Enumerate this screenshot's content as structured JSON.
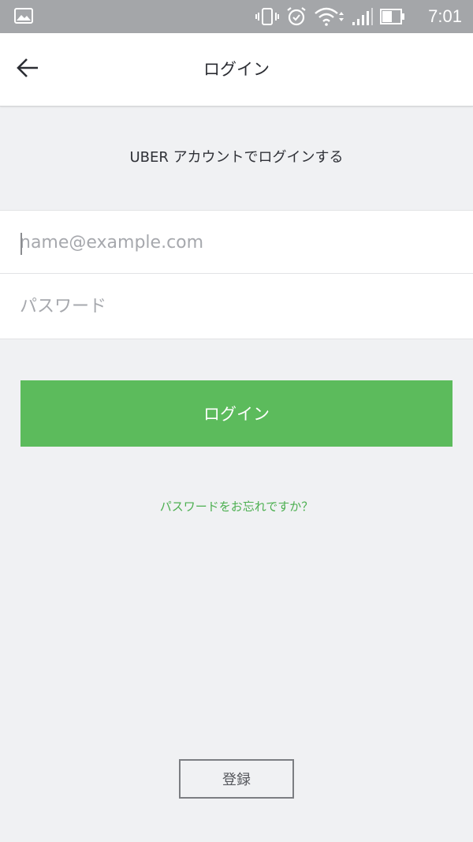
{
  "status_bar": {
    "time": "7:01",
    "icons": [
      "image-notification-icon",
      "vibrate-icon",
      "alarm-icon",
      "wifi-icon",
      "signal-icon",
      "battery-icon"
    ]
  },
  "header": {
    "title": "ログイン",
    "back_icon": "arrow-left-icon"
  },
  "main": {
    "subtitle": "UBER アカウントでログインする",
    "email_placeholder": "name@example.com",
    "password_placeholder": "パスワード",
    "login_label": "ログイン",
    "forgot_password": "パスワードをお忘れですか？",
    "register_label": "登録"
  },
  "colors": {
    "primary_green": "#5cbb5c",
    "link_green": "#4caf50",
    "background": "#f0f1f3",
    "status_bar": "#a4a6a9"
  }
}
